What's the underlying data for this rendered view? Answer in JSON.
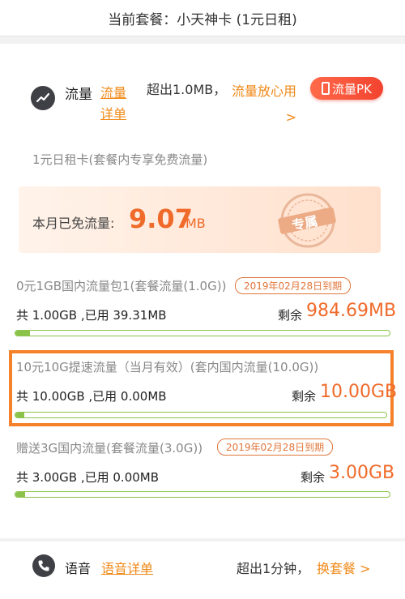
{
  "header": {
    "title": "当前套餐：小天神卡 (1元日租)"
  },
  "flow": {
    "title": "流量",
    "detail_link": "流量详单",
    "over_text": "超出1.0MB，",
    "worry_free": "流量放心用 >",
    "pk_label": "流量PK",
    "plan_note": "1元日租卡(套餐内专享免费流量)",
    "free_label": "本月已免流量:",
    "free_value": "9.07",
    "free_unit": "MB",
    "stamp_text": "专属"
  },
  "packages": [
    {
      "name": "0元1GB国内流量包1(套餐流量(1.0G))",
      "expiry": "2019年02月28日到期",
      "usage": "共 1.00GB ,已用 39.31MB",
      "remain_label": "剩余",
      "remain_value": "984.69MB",
      "used_fraction": 0.04
    },
    {
      "name": "10元10G提速流量（当月有效）(套内国内流量(10.0G))",
      "expiry": "",
      "usage": "共 10.00GB ,已用 0.00MB",
      "remain_label": "剩余",
      "remain_value": "10.00GB",
      "used_fraction": 0.0
    },
    {
      "name": "赠送3G国内流量(套餐流量(3.0G))",
      "expiry": "2019年02月28日到期",
      "usage": "共 3.00GB ,已用 0.00MB",
      "remain_label": "剩余",
      "remain_value": "3.00GB",
      "used_fraction": 0.0
    }
  ],
  "voice": {
    "title": "语音",
    "detail_link": "语音详单",
    "over_text": "超出1分钟，",
    "change_plan": "换套餐 >"
  },
  "colors": {
    "accent": "#f06a2a",
    "link": "#f08a1a",
    "bar": "#8bc34a",
    "highlight": "#f5822a",
    "pk": "#f2432f"
  }
}
